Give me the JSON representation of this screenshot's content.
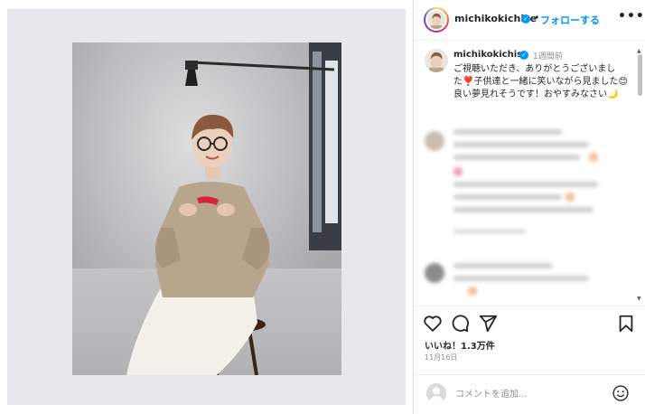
{
  "header": {
    "username": "michikokichise",
    "separator": "•",
    "follow_label": "フォローする",
    "more_label": "•••"
  },
  "caption": {
    "username": "michikokichise",
    "time": "1週間前",
    "text": "ご視聴いただき、ありがとうございました❣️子供達と一緒に笑いながら見ました😊良い夢見れそうです！おやすみなさい🌙"
  },
  "post": {
    "likes": "いいね！1.3万件",
    "date": "11月16日"
  },
  "comment_box": {
    "placeholder": "コメントを追加..."
  },
  "icons": {
    "verified": "verified-badge-icon",
    "more": "more-options-icon",
    "like": "heart-icon",
    "comment": "comment-bubble-icon",
    "share": "paper-plane-icon",
    "save": "bookmark-icon",
    "emoji": "smiley-icon",
    "user": "user-silhouette-icon"
  },
  "colors": {
    "accent": "#0095f6",
    "text": "#262626",
    "secondary": "#8e8e8e",
    "divider": "#dbdbdb"
  }
}
